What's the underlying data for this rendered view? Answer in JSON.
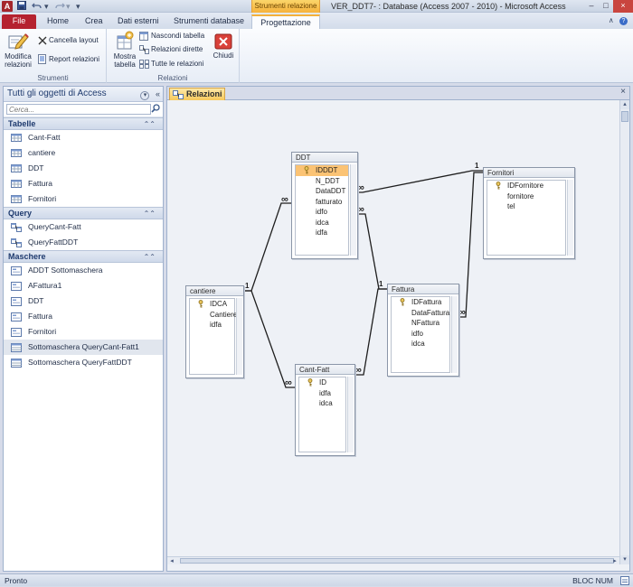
{
  "titlebar": {
    "app_icon": "A",
    "contextual_tab": "Strumenti relazione",
    "title": "VER_DDT7- : Database (Access 2007 - 2010) - Microsoft Access",
    "minimize": "–",
    "maximize": "□",
    "close": "×"
  },
  "ribbon_tabs": {
    "file": "File",
    "home": "Home",
    "crea": "Crea",
    "dati_esterni": "Dati esterni",
    "strumenti_database": "Strumenti database",
    "progettazione": "Progettazione"
  },
  "ribbon": {
    "strumenti": {
      "label": "Strumenti",
      "modifica": "Modifica relazioni",
      "cancella": "Cancella layout",
      "report": "Report relazioni"
    },
    "relazioni": {
      "label": "Relazioni",
      "mostra": "Mostra tabella",
      "nascondi": "Nascondi tabella",
      "dirette": "Relazioni dirette",
      "tutte": "Tutte le relazioni",
      "chiudi": "Chiudi"
    }
  },
  "navpane": {
    "title": "Tutti gli oggetti di Access",
    "search_placeholder": "Cerca...",
    "groups": [
      {
        "label": "Tabelle",
        "items": [
          "Cant-Fatt",
          "cantiere",
          "DDT",
          "Fattura",
          "Fornitori"
        ]
      },
      {
        "label": "Query",
        "items": [
          "QueryCant-Fatt",
          "QueryFattDDT"
        ]
      },
      {
        "label": "Maschere",
        "items": [
          "ADDT Sottomaschera",
          "AFattura1",
          "DDT",
          "Fattura",
          "Fornitori",
          "Sottomaschera QueryCant-Fatt1",
          "Sottomaschera QueryFattDDT"
        ]
      }
    ]
  },
  "document": {
    "tab_label": "Relazioni",
    "close": "×"
  },
  "tables": {
    "ddt": {
      "title": "DDT",
      "fields": [
        "IDDDT",
        "N_DDT",
        "DataDDT",
        "fatturato",
        "idfo",
        "idca",
        "idfa"
      ]
    },
    "fornitori": {
      "title": "Fornitori",
      "fields": [
        "IDFornitore",
        "fornitore",
        "tel"
      ]
    },
    "cantiere": {
      "title": "cantiere",
      "fields": [
        "IDCA",
        "Cantiere",
        "idfa"
      ]
    },
    "fattura": {
      "title": "Fattura",
      "fields": [
        "IDFattura",
        "DataFattura",
        "NFattura",
        "idfo",
        "idca"
      ]
    },
    "cantfatt": {
      "title": "Cant-Fatt",
      "fields": [
        "ID",
        "idfa",
        "idca"
      ]
    }
  },
  "relations": {
    "one": "1",
    "many": "∞"
  },
  "statusbar": {
    "left": "Pronto",
    "right": "BLOC NUM"
  },
  "colors": {
    "file_tab": "#b5222f",
    "accent": "#f3b13c",
    "key_highlight": "#fbc374"
  }
}
